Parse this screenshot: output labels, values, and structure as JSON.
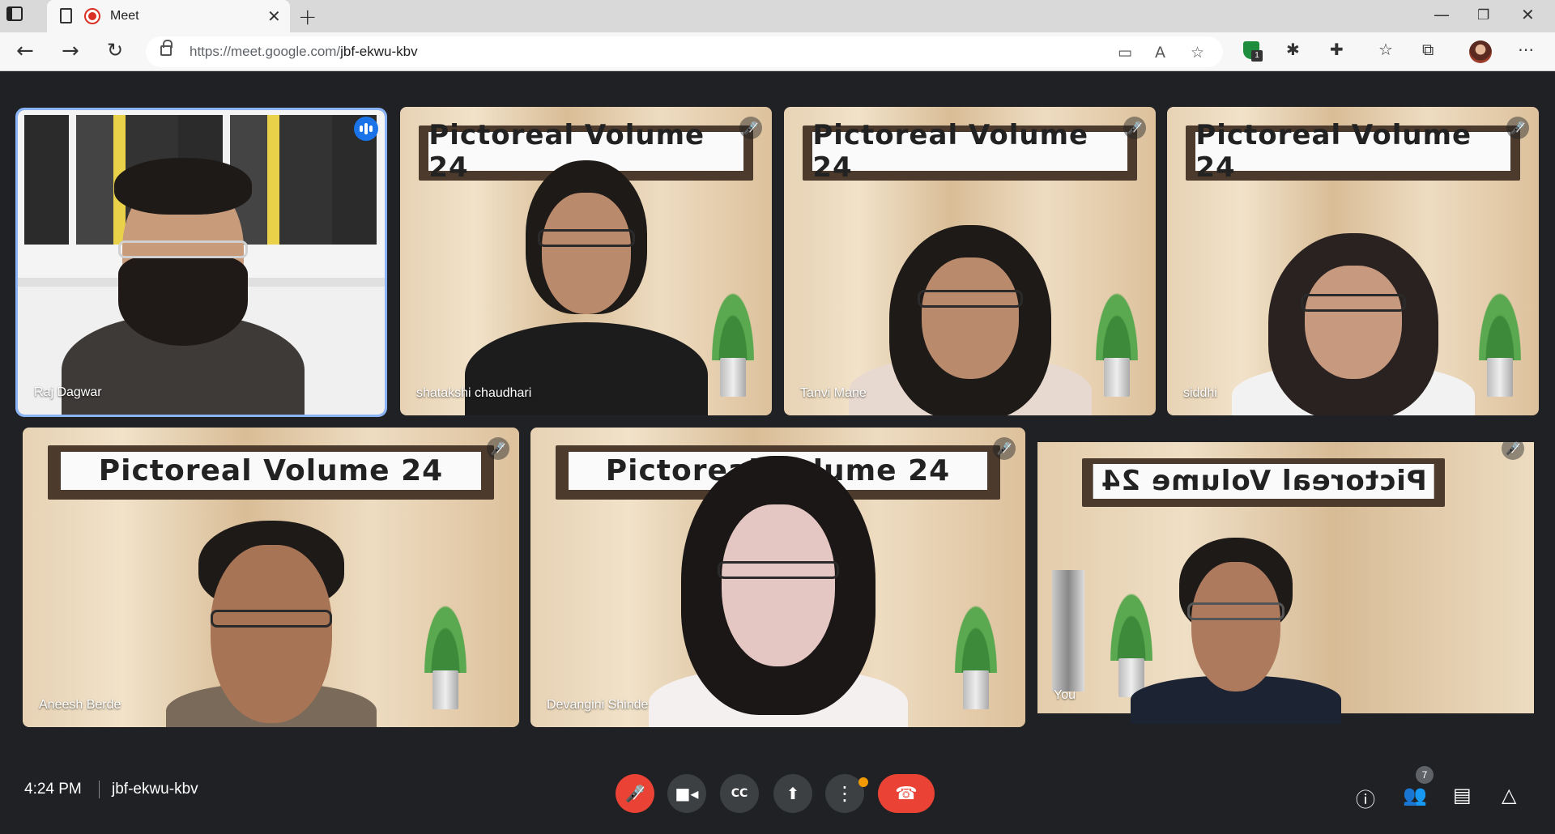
{
  "browser": {
    "tab_title": "Meet",
    "url_host": "https://meet.google.com/",
    "url_path": "jbf-ekwu-kbv",
    "extension_badge": "1"
  },
  "tiles": [
    {
      "name": "Raj Dagwar",
      "banner": "",
      "speaking": true
    },
    {
      "name": "shatakshi chaudhari",
      "banner": "Pictoreal Volume 24"
    },
    {
      "name": "Tanvi Mane",
      "banner": "Pictoreal Volume 24"
    },
    {
      "name": "siddhi",
      "banner": "Pictoreal Volume 24"
    },
    {
      "name": "Aneesh Berde",
      "banner": "Pictoreal Volume 24"
    },
    {
      "name": "Devangini Shinde",
      "banner": "Pictoreal Volume 24"
    },
    {
      "name": "You",
      "banner": "Pictoreal Volume 24"
    }
  ],
  "footer": {
    "time": "4:24 PM",
    "meeting_code": "jbf-ekwu-kbv",
    "participants_count": "7"
  },
  "icons": {
    "mic_off": "mic-off-icon",
    "camera": "videocam-icon",
    "captions": "closed-caption-icon",
    "present": "present-screen-icon",
    "more": "more-vert-icon",
    "end_call": "call-end-icon",
    "info": "info-icon",
    "people": "people-icon",
    "chat": "chat-icon",
    "activities": "activities-icon"
  },
  "colors": {
    "background": "#202124",
    "end_call": "#ea4335",
    "active_speaker_outline": "#8ab4f8",
    "speaking_badge": "#1a73e8",
    "notification_dot": "#f29900"
  }
}
